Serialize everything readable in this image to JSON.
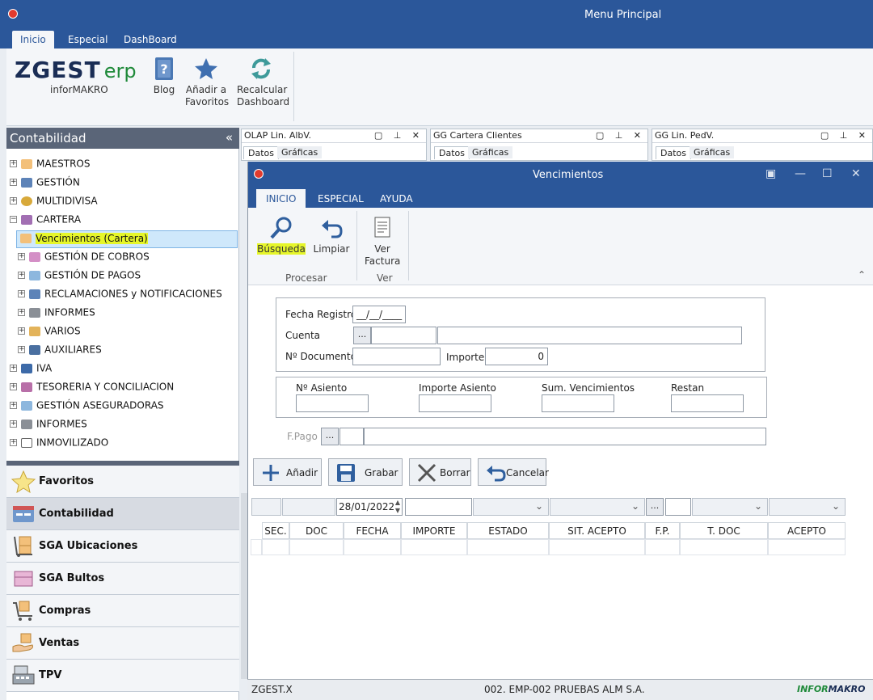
{
  "main_window": {
    "title": "Menu Principal",
    "tabs": [
      "Inicio",
      "Especial",
      "DashBoard"
    ],
    "logo_text": "ZGEST",
    "logo_suffix": "erp",
    "logo_subtitle": "inforMAKRO",
    "ribbon": {
      "blog": "Blog",
      "favorites_1": "Añadir a",
      "favorites_2": "Favoritos",
      "recalc_1": "Recalcular",
      "recalc_2": "Dashboard"
    }
  },
  "left_panel": {
    "title": "Contabilidad",
    "collapse": "«",
    "tree": [
      {
        "label": "MAESTROS",
        "exp": "+"
      },
      {
        "label": "GESTIÓN",
        "exp": "+"
      },
      {
        "label": "MULTIDIVISA",
        "exp": "+"
      },
      {
        "label": "CARTERA",
        "exp": "−"
      },
      {
        "label": "Vencimientos (Cartera)",
        "exp": ""
      },
      {
        "label": "GESTIÓN DE COBROS",
        "exp": "+"
      },
      {
        "label": "GESTIÓN DE PAGOS",
        "exp": "+"
      },
      {
        "label": "RECLAMACIONES y NOTIFICACIONES",
        "exp": "+"
      },
      {
        "label": "INFORMES",
        "exp": "+"
      },
      {
        "label": "VARIOS",
        "exp": "+"
      },
      {
        "label": "AUXILIARES",
        "exp": "+"
      },
      {
        "label": "IVA",
        "exp": "+"
      },
      {
        "label": "TESORERIA Y CONCILIACION",
        "exp": "+"
      },
      {
        "label": "GESTIÓN ASEGURADORAS",
        "exp": "+"
      },
      {
        "label": "INFORMES",
        "exp": "+"
      },
      {
        "label": "INMOVILIZADO",
        "exp": "+"
      }
    ],
    "nav": [
      "Favoritos",
      "Contabilidad",
      "SGA Ubicaciones",
      "SGA Bultos",
      "Compras",
      "Ventas",
      "TPV"
    ]
  },
  "docks": [
    {
      "title": "OLAP Lin. AlbV.",
      "tab1": "Datos",
      "tab2": "Gráficas"
    },
    {
      "title": "GG Cartera Clientes",
      "tab1": "Datos",
      "tab2": "Gráficas"
    },
    {
      "title": "GG Lin. PedV.",
      "tab1": "Datos",
      "tab2": "Gráficas"
    }
  ],
  "venc": {
    "title": "Vencimientos",
    "tabs": [
      "INICIO",
      "ESPECIAL",
      "AYUDA"
    ],
    "ribbon": {
      "busqueda": "Búsqueda",
      "limpiar": "Limpiar",
      "ver_1": "Ver",
      "ver_2": "Factura",
      "group_procesar": "Procesar",
      "group_ver": "Ver"
    },
    "form": {
      "fecha_label": "Fecha Registro",
      "fecha_value": "__/__/____",
      "cuenta_label": "Cuenta",
      "doc_label": "Nº Documento",
      "importe_label": "Importe",
      "importe_value": "0",
      "asiento_label": "Nº Asiento",
      "importe_asiento_label": "Importe Asiento",
      "sum_label": "Sum. Vencimientos",
      "restan_label": "Restan",
      "fpago_label": "F.Pago",
      "dots": "..."
    },
    "actions": [
      "Añadir",
      "Grabar",
      "Borrar",
      "Cancelar"
    ],
    "filter_date": "28/01/2022",
    "grid_headers": [
      "SEC.",
      "DOC",
      "FECHA",
      "IMPORTE",
      "ESTADO",
      "SIT. ACEPTO",
      "F.P.",
      "T. DOC",
      "ACEPTO"
    ],
    "status_left": "ZGEST.X",
    "status_center": "002. EMP-002 PRUEBAS ALM S.A.",
    "status_right_1": "INFOR",
    "status_right_2": "MAKRO"
  },
  "colors": {
    "accent": "#2b579a",
    "highlight": "#e6f62a",
    "logo_green": "#1f8a3a"
  }
}
